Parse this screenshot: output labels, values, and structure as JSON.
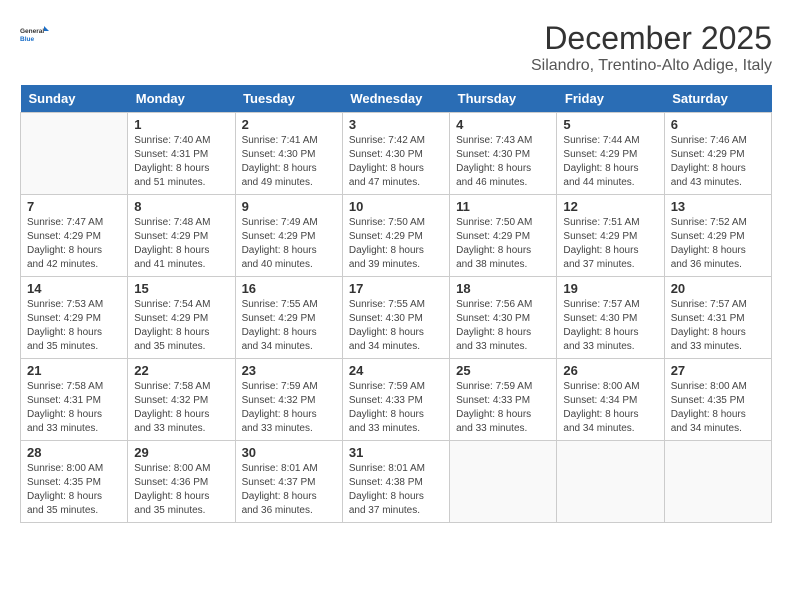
{
  "header": {
    "logo_line1": "General",
    "logo_line2": "Blue",
    "title": "December 2025",
    "subtitle": "Silandro, Trentino-Alto Adige, Italy"
  },
  "weekdays": [
    "Sunday",
    "Monday",
    "Tuesday",
    "Wednesday",
    "Thursday",
    "Friday",
    "Saturday"
  ],
  "weeks": [
    [
      {
        "day": "",
        "info": ""
      },
      {
        "day": "1",
        "info": "Sunrise: 7:40 AM\nSunset: 4:31 PM\nDaylight: 8 hours\nand 51 minutes."
      },
      {
        "day": "2",
        "info": "Sunrise: 7:41 AM\nSunset: 4:30 PM\nDaylight: 8 hours\nand 49 minutes."
      },
      {
        "day": "3",
        "info": "Sunrise: 7:42 AM\nSunset: 4:30 PM\nDaylight: 8 hours\nand 47 minutes."
      },
      {
        "day": "4",
        "info": "Sunrise: 7:43 AM\nSunset: 4:30 PM\nDaylight: 8 hours\nand 46 minutes."
      },
      {
        "day": "5",
        "info": "Sunrise: 7:44 AM\nSunset: 4:29 PM\nDaylight: 8 hours\nand 44 minutes."
      },
      {
        "day": "6",
        "info": "Sunrise: 7:46 AM\nSunset: 4:29 PM\nDaylight: 8 hours\nand 43 minutes."
      }
    ],
    [
      {
        "day": "7",
        "info": "Sunrise: 7:47 AM\nSunset: 4:29 PM\nDaylight: 8 hours\nand 42 minutes."
      },
      {
        "day": "8",
        "info": "Sunrise: 7:48 AM\nSunset: 4:29 PM\nDaylight: 8 hours\nand 41 minutes."
      },
      {
        "day": "9",
        "info": "Sunrise: 7:49 AM\nSunset: 4:29 PM\nDaylight: 8 hours\nand 40 minutes."
      },
      {
        "day": "10",
        "info": "Sunrise: 7:50 AM\nSunset: 4:29 PM\nDaylight: 8 hours\nand 39 minutes."
      },
      {
        "day": "11",
        "info": "Sunrise: 7:50 AM\nSunset: 4:29 PM\nDaylight: 8 hours\nand 38 minutes."
      },
      {
        "day": "12",
        "info": "Sunrise: 7:51 AM\nSunset: 4:29 PM\nDaylight: 8 hours\nand 37 minutes."
      },
      {
        "day": "13",
        "info": "Sunrise: 7:52 AM\nSunset: 4:29 PM\nDaylight: 8 hours\nand 36 minutes."
      }
    ],
    [
      {
        "day": "14",
        "info": "Sunrise: 7:53 AM\nSunset: 4:29 PM\nDaylight: 8 hours\nand 35 minutes."
      },
      {
        "day": "15",
        "info": "Sunrise: 7:54 AM\nSunset: 4:29 PM\nDaylight: 8 hours\nand 35 minutes."
      },
      {
        "day": "16",
        "info": "Sunrise: 7:55 AM\nSunset: 4:29 PM\nDaylight: 8 hours\nand 34 minutes."
      },
      {
        "day": "17",
        "info": "Sunrise: 7:55 AM\nSunset: 4:30 PM\nDaylight: 8 hours\nand 34 minutes."
      },
      {
        "day": "18",
        "info": "Sunrise: 7:56 AM\nSunset: 4:30 PM\nDaylight: 8 hours\nand 33 minutes."
      },
      {
        "day": "19",
        "info": "Sunrise: 7:57 AM\nSunset: 4:30 PM\nDaylight: 8 hours\nand 33 minutes."
      },
      {
        "day": "20",
        "info": "Sunrise: 7:57 AM\nSunset: 4:31 PM\nDaylight: 8 hours\nand 33 minutes."
      }
    ],
    [
      {
        "day": "21",
        "info": "Sunrise: 7:58 AM\nSunset: 4:31 PM\nDaylight: 8 hours\nand 33 minutes."
      },
      {
        "day": "22",
        "info": "Sunrise: 7:58 AM\nSunset: 4:32 PM\nDaylight: 8 hours\nand 33 minutes."
      },
      {
        "day": "23",
        "info": "Sunrise: 7:59 AM\nSunset: 4:32 PM\nDaylight: 8 hours\nand 33 minutes."
      },
      {
        "day": "24",
        "info": "Sunrise: 7:59 AM\nSunset: 4:33 PM\nDaylight: 8 hours\nand 33 minutes."
      },
      {
        "day": "25",
        "info": "Sunrise: 7:59 AM\nSunset: 4:33 PM\nDaylight: 8 hours\nand 33 minutes."
      },
      {
        "day": "26",
        "info": "Sunrise: 8:00 AM\nSunset: 4:34 PM\nDaylight: 8 hours\nand 34 minutes."
      },
      {
        "day": "27",
        "info": "Sunrise: 8:00 AM\nSunset: 4:35 PM\nDaylight: 8 hours\nand 34 minutes."
      }
    ],
    [
      {
        "day": "28",
        "info": "Sunrise: 8:00 AM\nSunset: 4:35 PM\nDaylight: 8 hours\nand 35 minutes."
      },
      {
        "day": "29",
        "info": "Sunrise: 8:00 AM\nSunset: 4:36 PM\nDaylight: 8 hours\nand 35 minutes."
      },
      {
        "day": "30",
        "info": "Sunrise: 8:01 AM\nSunset: 4:37 PM\nDaylight: 8 hours\nand 36 minutes."
      },
      {
        "day": "31",
        "info": "Sunrise: 8:01 AM\nSunset: 4:38 PM\nDaylight: 8 hours\nand 37 minutes."
      },
      {
        "day": "",
        "info": ""
      },
      {
        "day": "",
        "info": ""
      },
      {
        "day": "",
        "info": ""
      }
    ]
  ]
}
